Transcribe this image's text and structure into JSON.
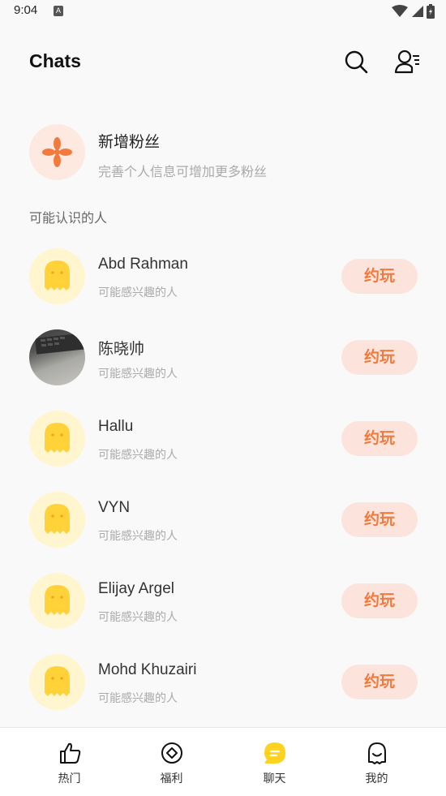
{
  "status_bar": {
    "time": "9:04",
    "notification_icon": "A"
  },
  "header": {
    "title": "Chats",
    "search_icon": "search-icon",
    "contacts_icon": "contacts-list-icon"
  },
  "new_fans": {
    "title": "新增粉丝",
    "subtitle": "完善个人信息可增加更多粉丝"
  },
  "section_label": "可能认识的人",
  "people": [
    {
      "name": "Abd Rahman",
      "subtitle": "可能感兴趣的人",
      "button": "约玩",
      "avatar": "ghost"
    },
    {
      "name": "陈晓帅",
      "subtitle": "可能感兴趣的人",
      "button": "约玩",
      "avatar": "photo"
    },
    {
      "name": "Hallu",
      "subtitle": "可能感兴趣的人",
      "button": "约玩",
      "avatar": "ghost"
    },
    {
      "name": "VYN",
      "subtitle": "可能感兴趣的人",
      "button": "约玩",
      "avatar": "ghost"
    },
    {
      "name": "Elijay Argel",
      "subtitle": "可能感兴趣的人",
      "button": "约玩",
      "avatar": "ghost"
    },
    {
      "name": "Mohd Khuzairi",
      "subtitle": "可能感兴趣的人",
      "button": "约玩",
      "avatar": "ghost"
    }
  ],
  "tabs": [
    {
      "label": "热门",
      "icon": "thumbs-up-icon"
    },
    {
      "label": "福利",
      "icon": "welfare-icon"
    },
    {
      "label": "聊天",
      "icon": "chat-icon",
      "active": true
    },
    {
      "label": "我的",
      "icon": "ghost-profile-icon"
    }
  ],
  "colors": {
    "accent": "#f07a3e",
    "button_bg": "#fce4dc",
    "chat_active": "#ffd21f",
    "ghost": "#ffd23a"
  }
}
